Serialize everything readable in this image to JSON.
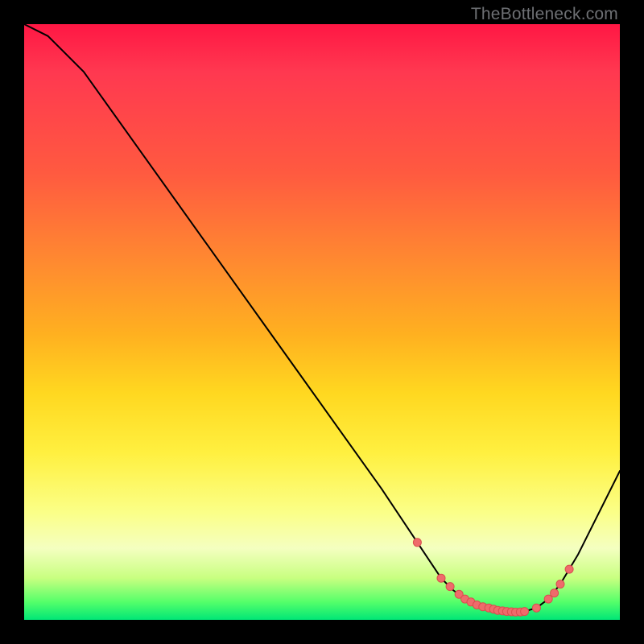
{
  "watermark": "TheBottleneck.com",
  "colors": {
    "gradient_top": "#ff1744",
    "gradient_bottom": "#00e676",
    "curve": "#000000",
    "dot_fill": "#ef6b6b",
    "dot_stroke": "#d94e4e"
  },
  "chart_data": {
    "type": "line",
    "title": "",
    "xlabel": "",
    "ylabel": "",
    "xlim": [
      0,
      100
    ],
    "ylim": [
      0,
      100
    ],
    "series": [
      {
        "name": "bottleneck-curve",
        "x": [
          0,
          4,
          6,
          10,
          20,
          30,
          40,
          50,
          60,
          66,
          70,
          72,
          74,
          76,
          78,
          80,
          82,
          84,
          86,
          88,
          90,
          93,
          96,
          100
        ],
        "y": [
          100,
          98,
          96,
          92,
          78,
          64,
          50,
          36,
          22,
          13,
          7,
          5,
          3.5,
          2.5,
          2,
          1.5,
          1.3,
          1.4,
          2.0,
          3.5,
          6,
          11,
          17,
          25
        ]
      }
    ],
    "markers": {
      "name": "highlighted-points",
      "x": [
        66,
        70,
        71.5,
        73,
        74,
        75,
        76,
        77,
        78,
        78.8,
        79.5,
        80.3,
        81,
        81.8,
        82.5,
        83.3,
        84,
        86,
        88,
        89,
        90,
        91.5
      ],
      "y": [
        13,
        7,
        5.6,
        4.3,
        3.5,
        3.0,
        2.5,
        2.2,
        2.0,
        1.8,
        1.6,
        1.5,
        1.4,
        1.35,
        1.3,
        1.32,
        1.4,
        2.0,
        3.5,
        4.5,
        6.0,
        8.5
      ]
    }
  }
}
